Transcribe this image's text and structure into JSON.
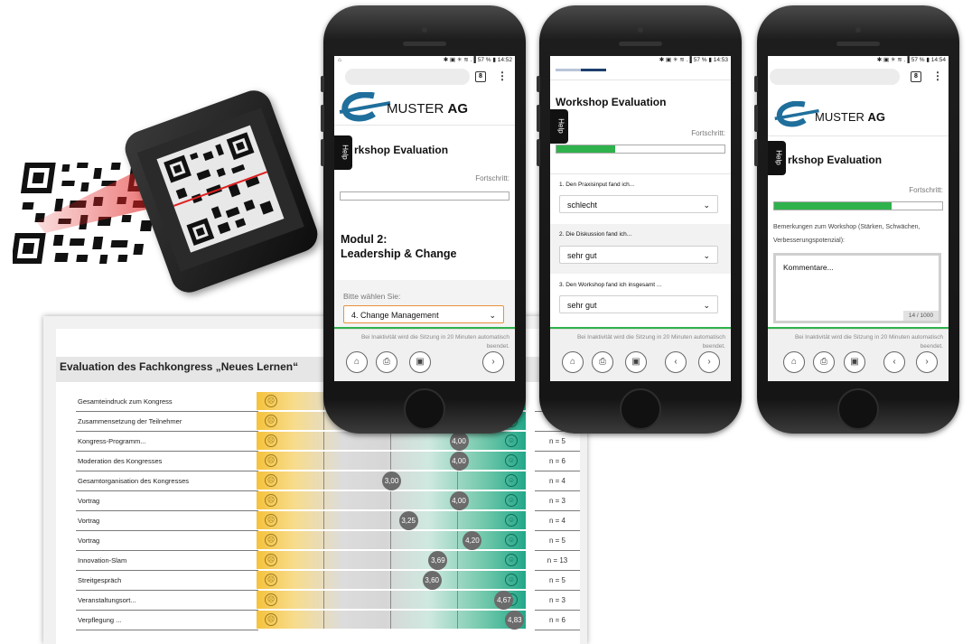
{
  "report": {
    "title": "Evaluation des Fachkongress „Neues Lernen“",
    "rows": [
      {
        "label": "Gesamteindruck zum Kongress",
        "value": "",
        "value_num": null,
        "n": ""
      },
      {
        "label": "Zusammensetzung der Teilnehmer",
        "value": "",
        "value_num": null,
        "n": ""
      },
      {
        "label": "Kongress-Programm...",
        "value": "4,00",
        "value_num": 4.0,
        "n": "n = 5"
      },
      {
        "label": "Moderation des Kongresses",
        "value": "4,00",
        "value_num": 4.0,
        "n": "n = 6"
      },
      {
        "label": "Gesamtorganisation des Kongresses",
        "value": "3,00",
        "value_num": 3.0,
        "n": "n = 4"
      },
      {
        "label": "Vortrag",
        "value": "4,00",
        "value_num": 4.0,
        "n": "n = 3"
      },
      {
        "label": "Vortrag",
        "value": "3,25",
        "value_num": 3.25,
        "n": "n = 4"
      },
      {
        "label": "Vortrag",
        "value": "4,20",
        "value_num": 4.2,
        "n": "n = 5"
      },
      {
        "label": "Innovation-Slam",
        "value": "3,69",
        "value_num": 3.69,
        "n": "n = 13"
      },
      {
        "label": "Streitgespräch",
        "value": "3,60",
        "value_num": 3.6,
        "n": "n = 5"
      },
      {
        "label": "Veranstaltungsort...",
        "value": "4,67",
        "value_num": 4.67,
        "n": "n = 3"
      },
      {
        "label": "Verpflegung ...",
        "value": "4,83",
        "value_num": 4.83,
        "n": "n = 6"
      }
    ],
    "icons": {
      "low": "sad-face-icon",
      "high": "happy-face-icon"
    }
  },
  "phone1": {
    "status_left": "⌂",
    "status_right": "✱ ▣ ✳ ≋ .▐ 57 % ▮ 14:52",
    "tabs_count": "8",
    "logo_muster": "MUSTER",
    "logo_ag": "AG",
    "help": "Help",
    "title": "rkshop Evaluation",
    "progress_label": "Fortschritt:",
    "progress": 0.0,
    "module_line1": "Modul 2:",
    "module_line2": "Leadership & Change",
    "select_prompt": "Bitte wählen Sie:",
    "select_value": "4. Change Management",
    "footer_note": "Bei Inaktivität wird die Sitzung in 20 Minuten automatisch beendet."
  },
  "phone2": {
    "status_right": "✱ ▣ ✳ ≋ .▐ 57 % ▮ 14:53",
    "help": "Help",
    "title": "Workshop Evaluation",
    "progress_label": "Fortschritt:",
    "progress": 0.35,
    "questions": [
      {
        "label": "1. Den Praxisinput fand ich...",
        "value": "schlecht"
      },
      {
        "label": "2. Die Diskussion fand ich...",
        "value": "sehr gut"
      },
      {
        "label": "3. Den Workshop fand ich insgesamt ...",
        "value": "sehr gut"
      }
    ],
    "footer_note": "Bei Inaktivität wird die Sitzung in 20 Minuten automatisch beendet."
  },
  "phone3": {
    "status_right": "✱ ▣ ✳ ≋ .▐ 57 % ▮ 14:54",
    "tabs_count": "8",
    "logo_muster": "MUSTER",
    "logo_ag": "AG",
    "help": "Help",
    "title": "rkshop Evaluation",
    "progress_label": "Fortschritt:",
    "progress": 0.7,
    "remarks_label": "Bemerkungen zum Workshop (Stärken, Schwächen, Verbesserungspotenzial):",
    "remarks_placeholder": "Kommentare...",
    "char_count": "14 / 1000",
    "footer_note": "Bei Inaktivität wird die Sitzung in 20 Minuten automatisch beendet."
  },
  "colors": {
    "accent_green": "#2fb24c",
    "logo_blue": "#1f6f9c",
    "scan_red": "#e02020"
  }
}
